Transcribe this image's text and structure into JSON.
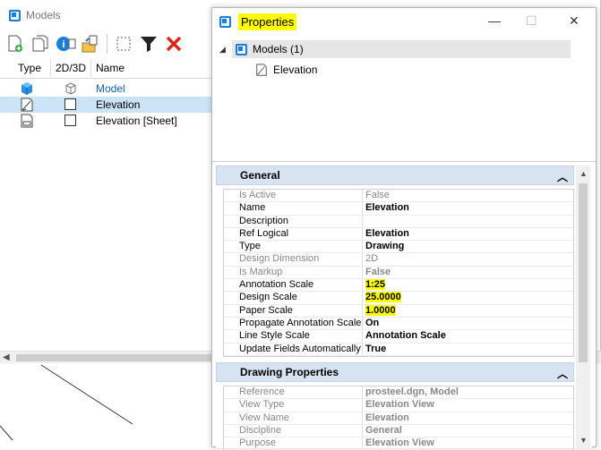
{
  "models_window": {
    "title": "Models",
    "columns": [
      "Type",
      "2D/3D",
      "Name"
    ],
    "rows": [
      {
        "name": "Model",
        "type": "3d-model",
        "selected": false,
        "active": true
      },
      {
        "name": "Elevation",
        "type": "drawing",
        "selected": true,
        "active": false
      },
      {
        "name": "Elevation [Sheet]",
        "type": "sheet",
        "selected": false,
        "active": false
      }
    ],
    "toolbar_icons": [
      "create-model-icon",
      "copy-model-icon",
      "model-properties-icon",
      "import-model-icon",
      "select-all-icon",
      "filter-icon",
      "delete-icon"
    ]
  },
  "properties_window": {
    "title": "Properties",
    "window_controls": {
      "minimize": "—",
      "maximize": "☐",
      "close": "✕"
    },
    "tree": {
      "root_label": "Models (1)",
      "child_label": "Elevation"
    },
    "sections": [
      {
        "title": "General",
        "properties": [
          {
            "key": "Is Active",
            "value": "False",
            "readonly": true
          },
          {
            "key": "Name",
            "value": "Elevation",
            "readonly": false
          },
          {
            "key": "Description",
            "value": "",
            "readonly": false
          },
          {
            "key": "Ref Logical",
            "value": "Elevation",
            "readonly": false
          },
          {
            "key": "Type",
            "value": "Drawing",
            "readonly": false
          },
          {
            "key": "Design Dimension",
            "value": "2D",
            "readonly": true
          },
          {
            "key": "Is Markup",
            "value": "False",
            "readonly": true
          },
          {
            "key": "Annotation Scale",
            "value": "1:25",
            "readonly": false,
            "highlight": true
          },
          {
            "key": "Design Scale",
            "value": "25.0000",
            "readonly": false,
            "highlight": true
          },
          {
            "key": "Paper Scale",
            "value": "1.0000",
            "readonly": false,
            "highlight": true
          },
          {
            "key": "Propagate Annotation Scale",
            "value": "On",
            "readonly": false
          },
          {
            "key": "Line Style Scale",
            "value": "Annotation Scale",
            "readonly": false
          },
          {
            "key": "Update Fields Automatically",
            "value": "True",
            "readonly": false
          }
        ]
      },
      {
        "title": "Drawing Properties",
        "properties": [
          {
            "key": "Reference",
            "value": "prosteel.dgn, Model",
            "readonly": true
          },
          {
            "key": "View Type",
            "value": "Elevation View",
            "readonly": true
          },
          {
            "key": "View Name",
            "value": "Elevation",
            "readonly": true
          },
          {
            "key": "Discipline",
            "value": "General",
            "readonly": true
          },
          {
            "key": "Purpose",
            "value": "Elevation View",
            "readonly": true
          }
        ]
      }
    ]
  },
  "colors": {
    "highlight": "#ffff00",
    "section_header": "#d7e3f1",
    "selection": "#cce4f7",
    "accent": "#1a7fd4"
  }
}
